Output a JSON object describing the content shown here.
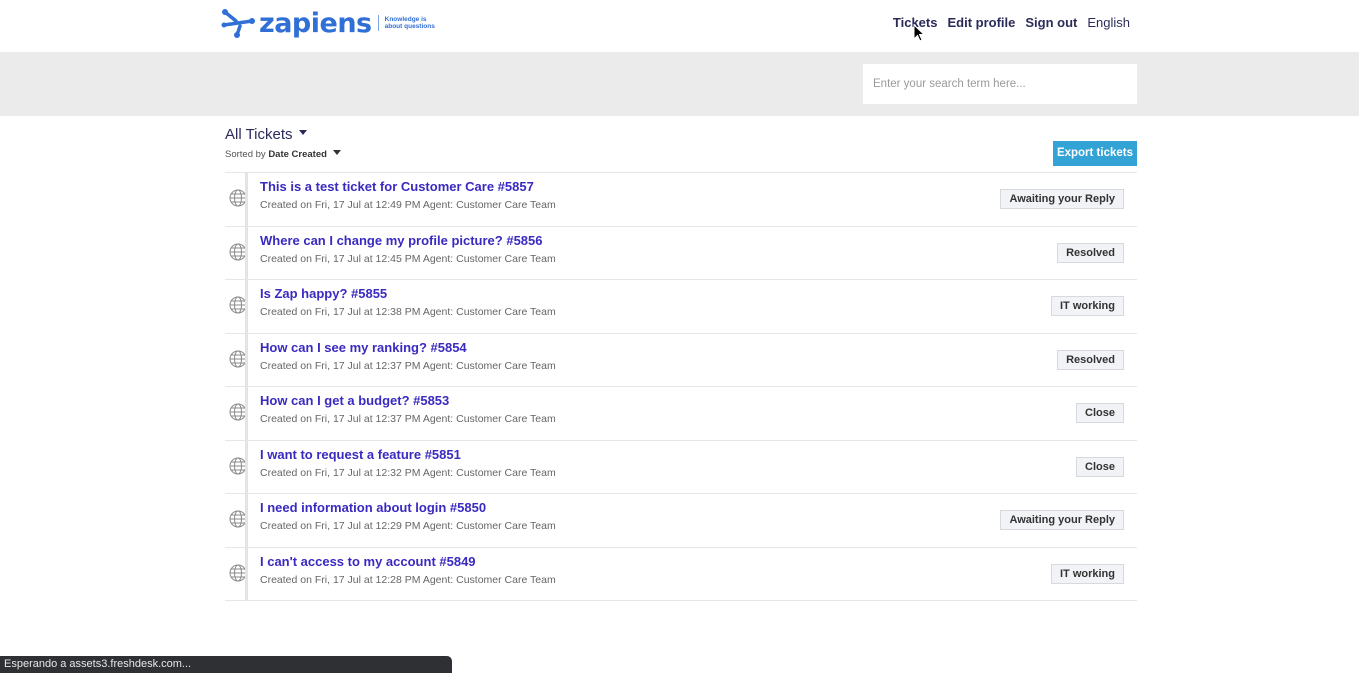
{
  "header": {
    "logo_text": "zapiens",
    "logo_tagline": "Knowledge is about questions",
    "nav": {
      "tickets": "Tickets",
      "edit_profile": "Edit profile",
      "sign_out": "Sign out",
      "language": "English"
    }
  },
  "search": {
    "placeholder": "Enter your search term here..."
  },
  "tickets_view": {
    "filter_label": "All Tickets",
    "sorted_by_prefix": "Sorted by",
    "sorted_by_value": "Date Created",
    "export_label": "Export tickets"
  },
  "tickets": [
    {
      "title": "This is a test ticket for Customer Care #5857",
      "meta": "Created on Fri, 17 Jul at 12:49 PM Agent: Customer Care Team",
      "status": "Awaiting your Reply"
    },
    {
      "title": "Where can I change my profile picture? #5856",
      "meta": "Created on Fri, 17 Jul at 12:45 PM Agent: Customer Care Team",
      "status": "Resolved"
    },
    {
      "title": "Is Zap happy? #5855",
      "meta": "Created on Fri, 17 Jul at 12:38 PM Agent: Customer Care Team",
      "status": "IT working"
    },
    {
      "title": "How can I see my ranking? #5854",
      "meta": "Created on Fri, 17 Jul at 12:37 PM Agent: Customer Care Team",
      "status": "Resolved"
    },
    {
      "title": "How can I get a budget? #5853",
      "meta": "Created on Fri, 17 Jul at 12:37 PM Agent: Customer Care Team",
      "status": "Close"
    },
    {
      "title": "I want to request a feature #5851",
      "meta": "Created on Fri, 17 Jul at 12:32 PM Agent: Customer Care Team",
      "status": "Close"
    },
    {
      "title": "I need information about login #5850",
      "meta": "Created on Fri, 17 Jul at 12:29 PM Agent: Customer Care Team",
      "status": "Awaiting your Reply"
    },
    {
      "title": "I can't access to my account #5849",
      "meta": "Created on Fri, 17 Jul at 12:28 PM Agent: Customer Care Team",
      "status": "IT working"
    }
  ],
  "browser_status": "Esperando a assets3.freshdesk.com...",
  "colors": {
    "brand": "#2f6fd6",
    "ticket_title": "#3a2ac0",
    "export_button": "#33a3d6",
    "search_band": "#ebebeb"
  }
}
